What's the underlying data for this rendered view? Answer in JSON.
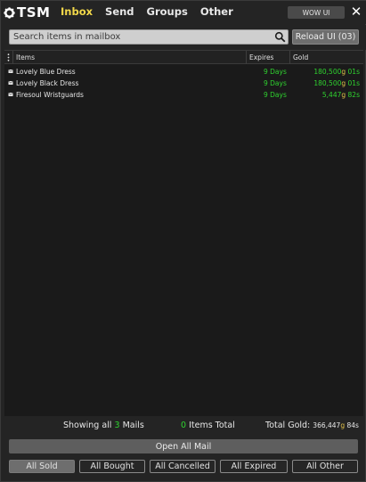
{
  "header": {
    "logo_text": "TSM",
    "tabs": [
      {
        "label": "Inbox",
        "active": true
      },
      {
        "label": "Send",
        "active": false
      },
      {
        "label": "Groups",
        "active": false
      },
      {
        "label": "Other",
        "active": false
      }
    ],
    "wowui_label": "WOW UI",
    "close_glyph": "✕"
  },
  "search": {
    "placeholder": "Search items in mailbox",
    "value": "",
    "icon": "search-icon",
    "reload_label": "Reload UI (03)"
  },
  "table": {
    "columns": [
      "Items",
      "Expires",
      "Gold"
    ],
    "rows": [
      {
        "icon": "mail-icon",
        "name": "Lovely Blue Dress",
        "expires": "9 Days",
        "gold_g": "180,500",
        "gold_s": "01",
        "unit_g": "g",
        "unit_s": "s"
      },
      {
        "icon": "mail-icon",
        "name": "Lovely Black Dress",
        "expires": "9 Days",
        "gold_g": "180,500",
        "gold_s": "01",
        "unit_g": "g",
        "unit_s": "s"
      },
      {
        "icon": "mail-icon",
        "name": "Firesoul Wristguards",
        "expires": "9 Days",
        "gold_g": "5,447",
        "gold_s": "82",
        "unit_g": "g",
        "unit_s": "s"
      }
    ]
  },
  "summary": {
    "mails_prefix": "Showing all",
    "mails_count": "3",
    "mails_suffix": "Mails",
    "items_count": "0",
    "items_label": "Items Total",
    "gold_label": "Total Gold:",
    "gold_g": "366,447",
    "gold_s": "84",
    "unit_g": "g",
    "unit_s": "s"
  },
  "actions": {
    "open_all_label": "Open All Mail",
    "filters": [
      {
        "label": "All Sold",
        "active": true
      },
      {
        "label": "All Bought",
        "active": false
      },
      {
        "label": "All Cancelled",
        "active": false
      },
      {
        "label": "All Expired",
        "active": false
      },
      {
        "label": "All Other",
        "active": false
      }
    ]
  },
  "colors": {
    "accent_yellow": "#f2d84a",
    "value_green": "#2fd22f",
    "gold_unit": "#e3c34a",
    "background": "#242424"
  }
}
